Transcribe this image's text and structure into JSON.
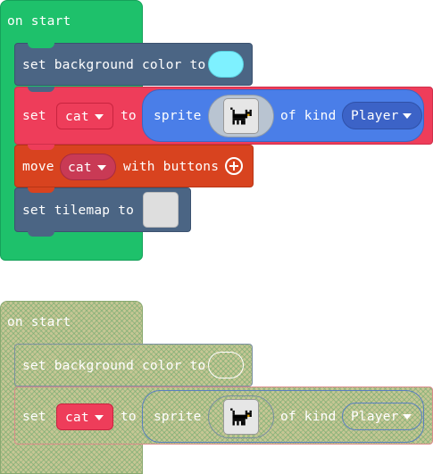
{
  "stack1": {
    "hat_label": "on start",
    "bg_block": {
      "label": "set background color to",
      "color": "#7ef1ff"
    },
    "set_block": {
      "set_label": "set",
      "var_name": "cat",
      "to_label": "to",
      "sprite_label": "sprite",
      "of_kind_label": "of kind",
      "kind_value": "Player",
      "sprite_icon": "cat-sprite-icon"
    },
    "move_block": {
      "label_move": "move",
      "var_name": "cat",
      "label_with": "with buttons"
    },
    "tilemap_block": {
      "label": "set tilemap to"
    }
  },
  "stack2": {
    "hat_label": "on start",
    "bg_block": {
      "label": "set background color to"
    },
    "set_block": {
      "set_label": "set",
      "var_name": "cat",
      "to_label": "to",
      "sprite_label": "sprite",
      "of_kind_label": "of kind",
      "kind_value": "Player",
      "sprite_icon": "cat-sprite-icon"
    }
  },
  "colors": {
    "event_green": "#1ec16b",
    "scene_slate": "#4b6584",
    "sprite_red": "#ee3d5a",
    "controller_orange": "#d8431f",
    "sprite_blue": "#4a7ee8",
    "kind_blue": "#3c63c7",
    "disabled_olive": "#c6c694"
  }
}
